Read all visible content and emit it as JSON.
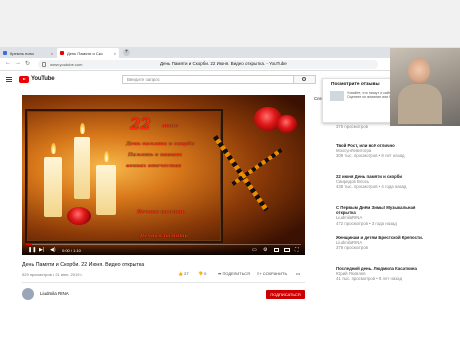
{
  "browser": {
    "tabs": [
      {
        "label": "Кремль ново",
        "active": false
      },
      {
        "label": "День Памяти и Ско",
        "active": true
      }
    ],
    "url": "www.youtube.com",
    "window_title": "День Памяти и Скорби. 22 Июня. Видео открытка. - YouTube"
  },
  "youtube": {
    "logo_text": "YouTube",
    "logo_sup": "RU",
    "search_placeholder": "Введите запрос",
    "video": {
      "overlay_22": "22",
      "overlay_word": "июня",
      "line1": "День памяти и скорби",
      "line2": "Память о павших",
      "line3": "воинах отечества",
      "line4": "Вечная память",
      "line5": "Вечная память",
      "time": "0:00 / 1:10",
      "progress": 0.02
    },
    "title": "День Памяти и Скорби. 22 Июня. Видео открытка",
    "views": "529 просмотров • 21 июн. 2019 г.",
    "likes": "27",
    "dislikes": "0",
    "share": "ПОДЕЛИТЬСЯ",
    "save": "СОХРАНИТЬ",
    "more": "•••",
    "channel": "Liudmila RINA",
    "subscribe": "ПОДПИСАТЬСЯ",
    "next_label": "Сле"
  },
  "popup": {
    "heading": "Посмотрите отзывы",
    "body": "Узнайте, что пишут о сайте. Оцените их влияние или без."
  },
  "sidebar": {
    "items": [
      {
        "title": "",
        "meta": "ВЕРА КИТЕХУА",
        "sub": "375 просмотров"
      },
      {
        "title": "Твой Рост, или всё отлично",
        "meta": "МохсунЛевитогра",
        "sub": "308 тыс. просмотров • 8 лет назад"
      },
      {
        "title": "22 июня День памяти и скорби",
        "meta": "Свиридов Влось",
        "sub": "438 тыс. просмотров • 4 года назад"
      },
      {
        "title": "С Первым Днём Зимы! Музыкальная открытка",
        "meta": "LiudmilaRINA",
        "sub": "472 просмотров • 3 года назад"
      },
      {
        "title": "Женщинам и детям Брестской Крепости.",
        "meta": "LiudmilaRINA",
        "sub": "378 просмотров"
      },
      {
        "title": "Последний день. Людмила Касаткина",
        "meta": "Юрий Яковлев",
        "sub": "41 тыс. просмотров • 8 лет назад"
      }
    ]
  }
}
